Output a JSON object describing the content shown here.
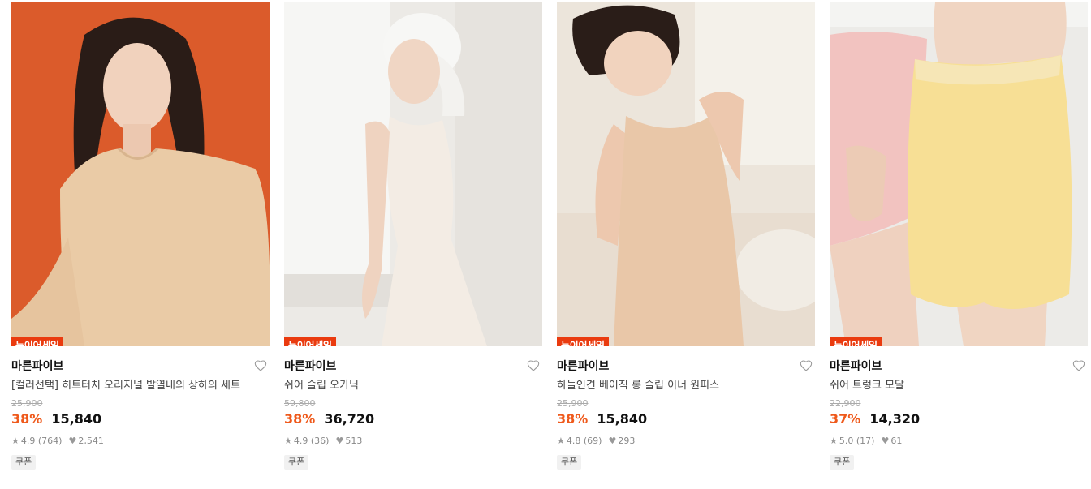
{
  "products": [
    {
      "badge": "뉴이어세일",
      "brand": "마른파이브",
      "title": "[컬러선택] 히트터치 오리지널 발열내의 상하의 세트",
      "original_price": "25,900",
      "discount": "38%",
      "price": "15,840",
      "rating": "4.9 (764)",
      "likes": "2,541",
      "coupon": "쿠폰",
      "image_desc": "woman-in-beige-long-sleeve-on-orange-background"
    },
    {
      "badge": "뉴이어세일",
      "brand": "마른파이브",
      "title": "쉬어 슬립 오가닉",
      "original_price": "59,800",
      "discount": "38%",
      "price": "36,720",
      "rating": "4.9 (36)",
      "likes": "513",
      "coupon": "쿠폰",
      "image_desc": "woman-in-ivory-slip-dress-by-window"
    },
    {
      "badge": "뉴이어세일",
      "brand": "마른파이브",
      "title": "하늘인견 베이직 롱 슬립 이너 원피스",
      "original_price": "25,900",
      "discount": "38%",
      "price": "15,840",
      "rating": "4.8 (69)",
      "likes": "293",
      "coupon": "쿠폰",
      "image_desc": "woman-in-beige-slip-dress"
    },
    {
      "badge": "뉴이어세일",
      "brand": "마른파이브",
      "title": "쉬어 트렁크 모달",
      "original_price": "22,900",
      "discount": "37%",
      "price": "14,320",
      "rating": "5.0 (17)",
      "likes": "61",
      "coupon": "쿠폰",
      "image_desc": "yellow-and-pink-trunk-shorts"
    }
  ],
  "colors": {
    "badge_bg": "#ea3b0f",
    "discount": "#ef5a1c",
    "text": "#111111",
    "muted": "#888888"
  }
}
